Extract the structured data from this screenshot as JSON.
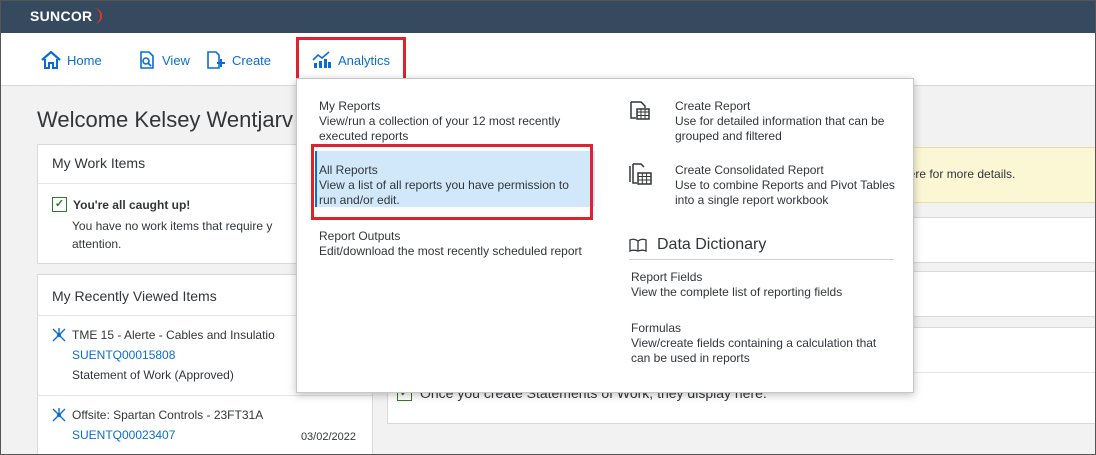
{
  "brand": {
    "logo_text": "SUNCOR"
  },
  "nav": {
    "home": "Home",
    "view": "View",
    "create": "Create",
    "analytics": "Analytics"
  },
  "page": {
    "welcome": "Welcome Kelsey Wentjarv",
    "work_items": {
      "title": "My Work Items",
      "caught_up": "You're all caught up!",
      "message": "You have no work items that require y attention."
    },
    "recent": {
      "title": "My Recently Viewed Items",
      "items": [
        {
          "title": "TME 15 - Alerte - Cables and Insulatio",
          "code": "SUENTQ00015808",
          "status": "Statement of Work (Approved)",
          "date": ""
        },
        {
          "title": "Offsite: Spartan Controls - 23FT31A",
          "code": "SUENTQ00023407",
          "status": "",
          "date": "03/02/2022"
        }
      ]
    },
    "notice": "here for more details.",
    "sow_empty": "Once you create Statements of Work, they display here."
  },
  "analytics_menu": {
    "left": [
      {
        "title": "My Reports",
        "desc": "View/run a collection of your 12 most recently executed reports"
      },
      {
        "title": "All Reports",
        "desc": "View a list of all reports you have permission to run and/or edit."
      },
      {
        "title": "Report Outputs",
        "desc": "Edit/download the most recently scheduled report"
      }
    ],
    "right": [
      {
        "title": "Create Report",
        "desc": "Use for detailed information that can be grouped and filtered",
        "icon": "create-report-icon"
      },
      {
        "title": "Create Consolidated Report",
        "desc": "Use to combine Reports and Pivot Tables into a single report workbook",
        "icon": "consolidated-report-icon"
      }
    ],
    "data_dictionary": {
      "heading": "Data Dictionary",
      "items": [
        {
          "title": "Report Fields",
          "desc": "View the complete list of reporting fields"
        },
        {
          "title": "Formulas",
          "desc": "View/create fields containing a calculation that can be used in reports"
        }
      ]
    }
  },
  "colors": {
    "topbar": "#354a5f",
    "link": "#0a6ed1",
    "highlight": "#e0222e",
    "selected_bg": "#d1e8fa"
  }
}
